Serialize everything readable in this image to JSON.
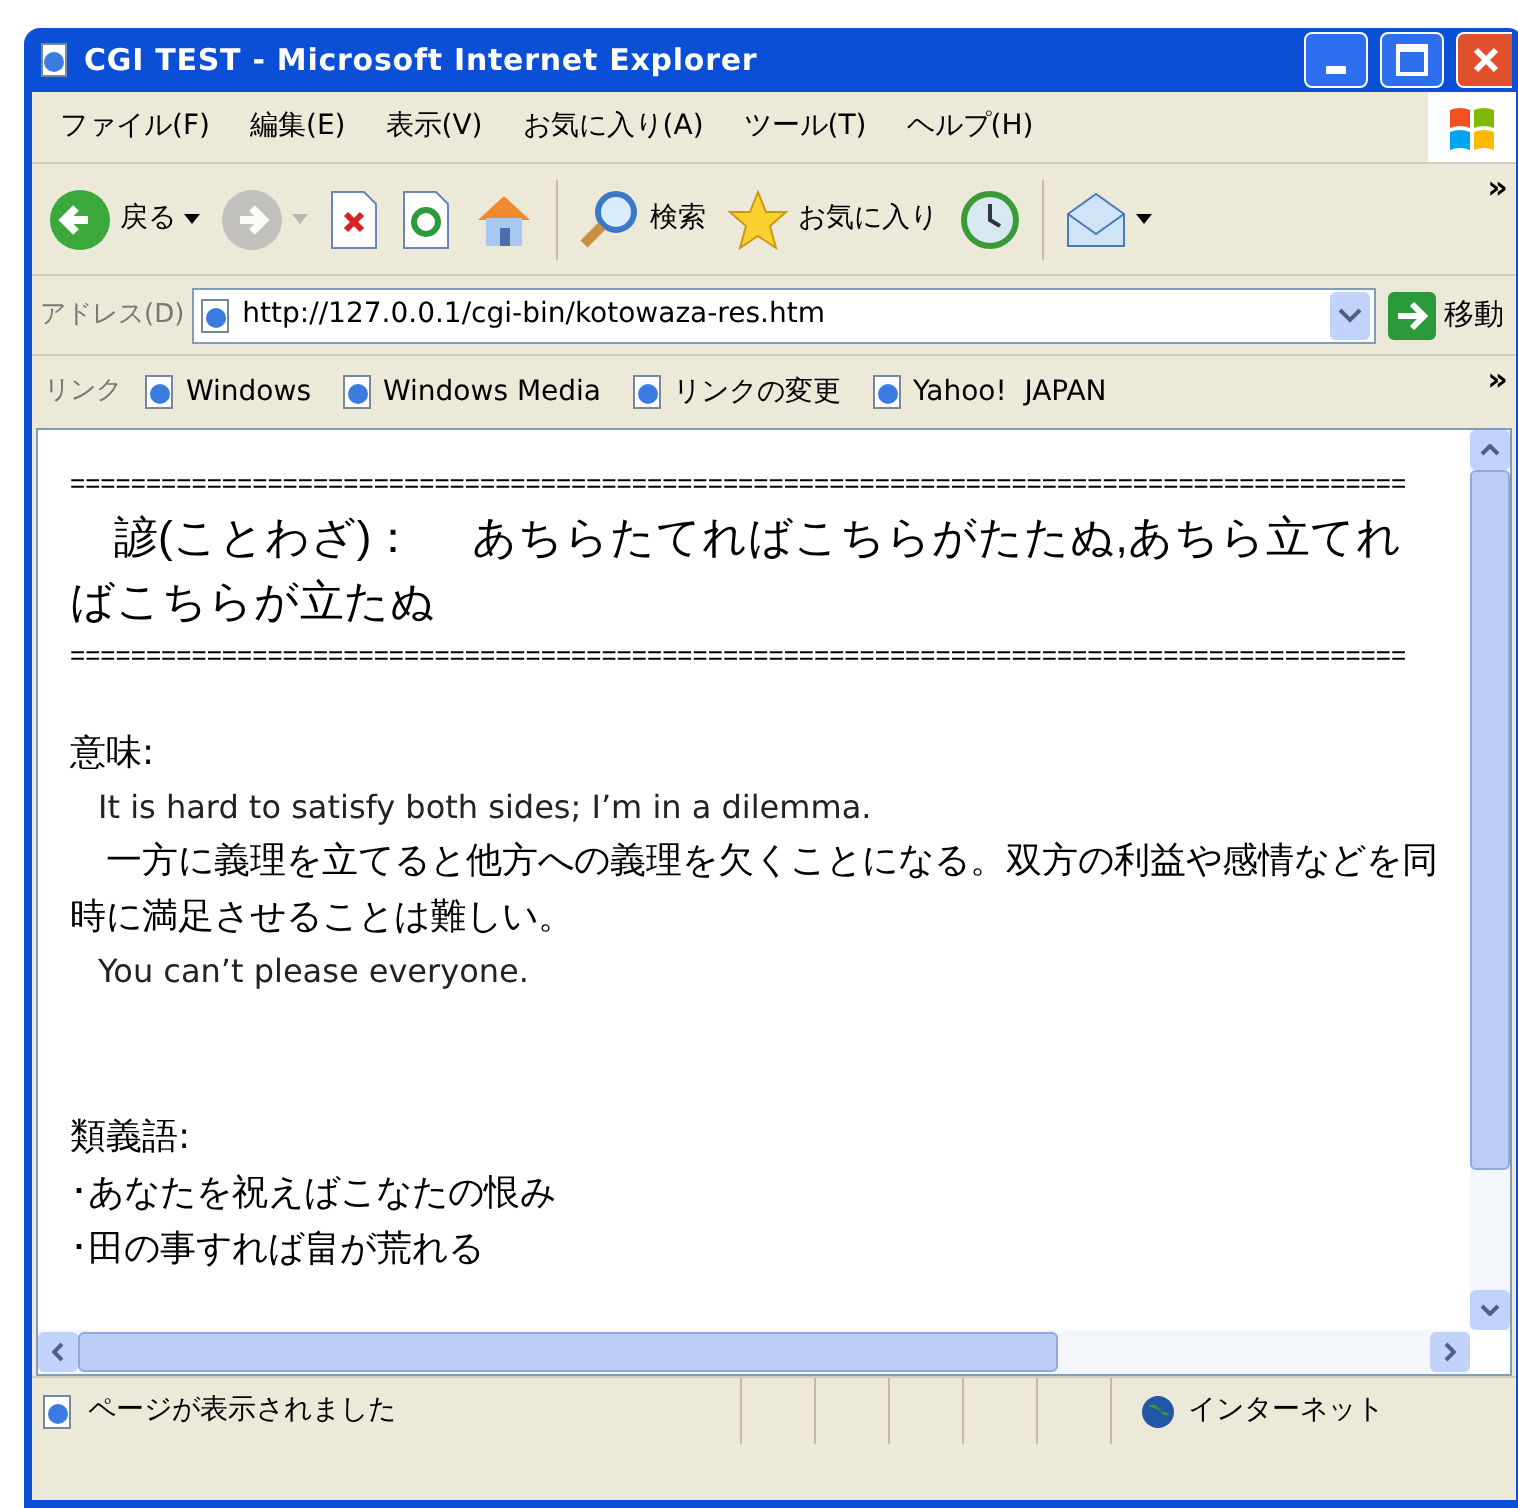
{
  "window": {
    "title": "CGI TEST - Microsoft Internet Explorer"
  },
  "menu": [
    "ファイル(F)",
    "編集(E)",
    "表示(V)",
    "お気に入り(A)",
    "ツール(T)",
    "ヘルプ(H)"
  ],
  "toolbar": [
    {
      "kind": "back",
      "label": "戻る",
      "disabled": false
    },
    {
      "kind": "forward",
      "disabled": true
    },
    {
      "kind": "stop"
    },
    {
      "kind": "refresh"
    },
    {
      "kind": "home"
    },
    {
      "kind": "search",
      "label": "検索"
    },
    {
      "kind": "favorites",
      "label": "お気に入り"
    },
    {
      "kind": "history"
    },
    {
      "kind": "mail"
    }
  ],
  "chevron": "»",
  "address": {
    "label": "アドレス(D)",
    "url": "http://127.0.0.1/cgi-bin/kotowaza-res.htm",
    "go": "移動"
  },
  "links": {
    "label": "リンク",
    "items": [
      "Windows",
      "Windows Media",
      "リンクの変更",
      "Yahoo!  JAPAN"
    ],
    "chevron": "»"
  },
  "content": [
    {
      "kind": "rule",
      "text": "========================================================================================"
    },
    {
      "kind": "heading",
      "text": "　諺(ことわざ)：　 あちらたてればこちらがたたぬ,あちら立てればこちらが立たぬ"
    },
    {
      "kind": "rule",
      "text": "========================================================================================"
    },
    {
      "kind": "gap"
    },
    {
      "kind": "label",
      "text": "意味:"
    },
    {
      "kind": "english",
      "text": "It is hard to satisfy both sides; I’m in a dilemma."
    },
    {
      "kind": "body",
      "text": "　一方に義理を立てると他方への義理を欠くことになる。双方の利益や感情などを同時に満足させることは難しい。"
    },
    {
      "kind": "english",
      "text": "You can’t please everyone."
    },
    {
      "kind": "gap"
    },
    {
      "kind": "gap"
    },
    {
      "kind": "label",
      "text": "類義語:"
    },
    {
      "kind": "body",
      "text": "･あなたを祝えばこなたの恨み"
    },
    {
      "kind": "body",
      "text": "･田の事すれば畠が荒れる"
    }
  ],
  "status": {
    "text": "ページが表示されました",
    "zone": "インターネット"
  }
}
